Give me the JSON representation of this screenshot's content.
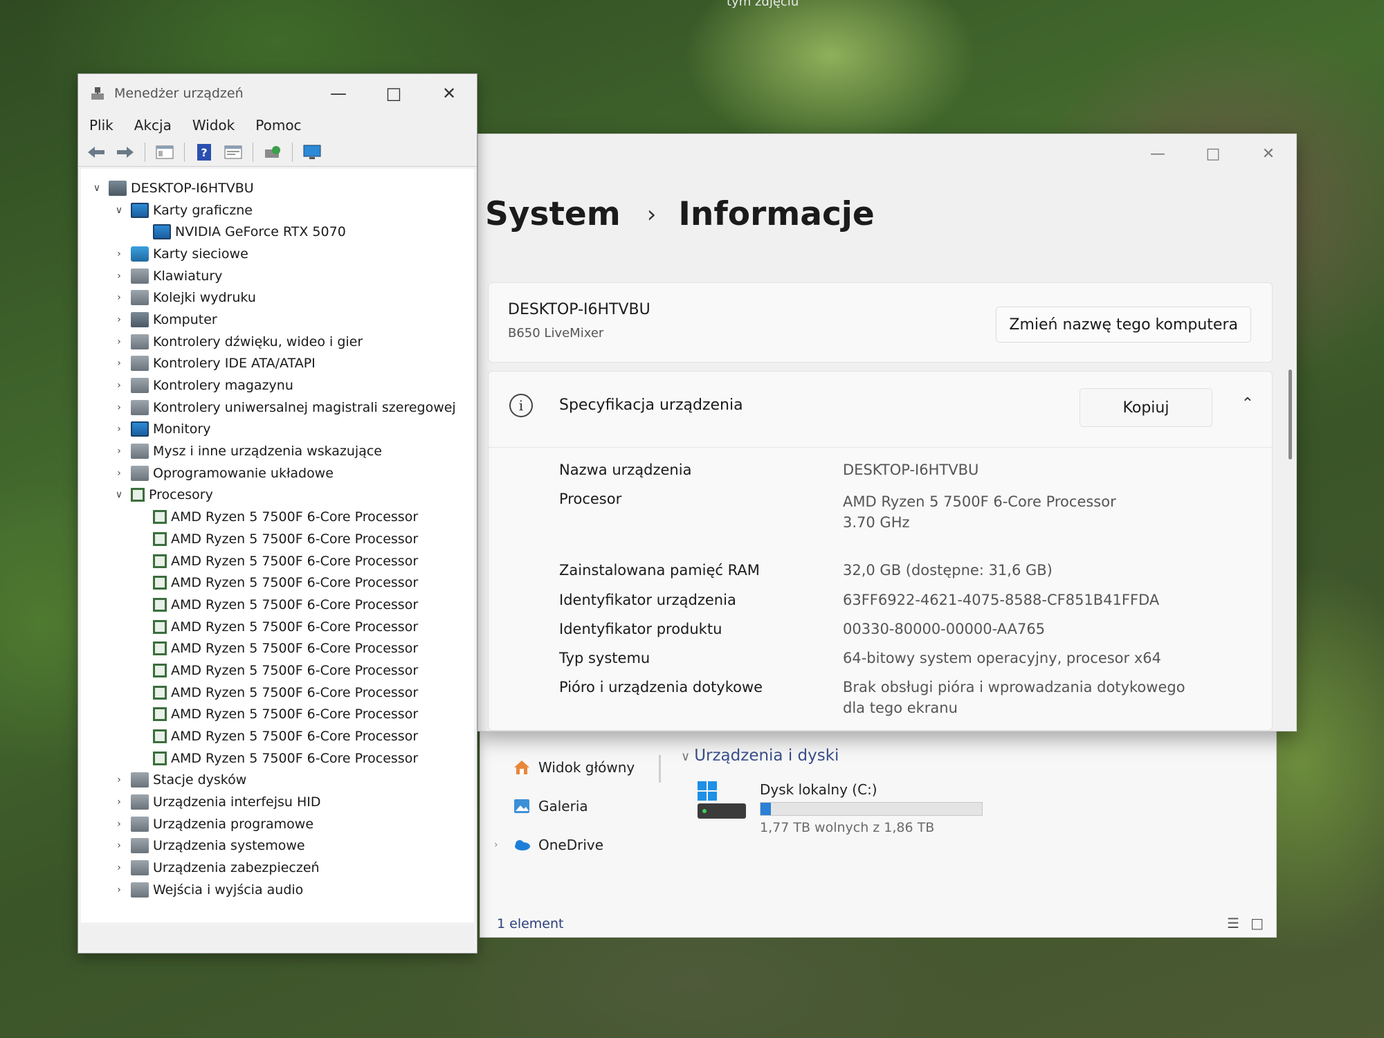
{
  "desktop": {
    "caption": "tym zdjęciu"
  },
  "device_manager": {
    "title": "Menedżer urządzeń",
    "menu": [
      "Plik",
      "Akcja",
      "Widok",
      "Pomoc"
    ],
    "root": "DESKTOP-I6HTVBU",
    "tree": [
      {
        "label": "Karty graficzne",
        "expanded": true,
        "icon": "display-adapter-icon",
        "children": [
          "NVIDIA GeForce RTX 5070"
        ]
      },
      {
        "label": "Karty sieciowe",
        "icon": "network-adapter-icon"
      },
      {
        "label": "Klawiatury",
        "icon": "keyboard-icon"
      },
      {
        "label": "Kolejki wydruku",
        "icon": "printer-icon"
      },
      {
        "label": "Komputer",
        "icon": "computer-icon"
      },
      {
        "label": "Kontrolery dźwięku, wideo i gier",
        "icon": "speaker-icon"
      },
      {
        "label": "Kontrolery IDE ATA/ATAPI",
        "icon": "ide-controller-icon"
      },
      {
        "label": "Kontrolery magazynu",
        "icon": "storage-controller-icon"
      },
      {
        "label": "Kontrolery uniwersalnej magistrali szeregowej",
        "icon": "usb-icon"
      },
      {
        "label": "Monitory",
        "icon": "monitor-icon"
      },
      {
        "label": "Mysz i inne urządzenia wskazujące",
        "icon": "mouse-icon"
      },
      {
        "label": "Oprogramowanie układowe",
        "icon": "firmware-icon"
      },
      {
        "label": "Procesory",
        "expanded": true,
        "icon": "processor-icon",
        "children": [
          "AMD Ryzen 5 7500F 6-Core Processor",
          "AMD Ryzen 5 7500F 6-Core Processor",
          "AMD Ryzen 5 7500F 6-Core Processor",
          "AMD Ryzen 5 7500F 6-Core Processor",
          "AMD Ryzen 5 7500F 6-Core Processor",
          "AMD Ryzen 5 7500F 6-Core Processor",
          "AMD Ryzen 5 7500F 6-Core Processor",
          "AMD Ryzen 5 7500F 6-Core Processor",
          "AMD Ryzen 5 7500F 6-Core Processor",
          "AMD Ryzen 5 7500F 6-Core Processor",
          "AMD Ryzen 5 7500F 6-Core Processor",
          "AMD Ryzen 5 7500F 6-Core Processor"
        ]
      },
      {
        "label": "Stacje dysków",
        "icon": "disk-drive-icon"
      },
      {
        "label": "Urządzenia interfejsu HID",
        "icon": "hid-icon"
      },
      {
        "label": "Urządzenia programowe",
        "icon": "software-device-icon"
      },
      {
        "label": "Urządzenia systemowe",
        "icon": "system-device-icon"
      },
      {
        "label": "Urządzenia zabezpieczeń",
        "icon": "security-device-icon"
      },
      {
        "label": "Wejścia i wyjścia audio",
        "icon": "audio-io-icon"
      }
    ]
  },
  "settings": {
    "breadcrumb": {
      "parent": "System",
      "separator": "›",
      "current": "Informacje"
    },
    "pc": {
      "name": "DESKTOP-I6HTVBU",
      "model": "B650 LiveMixer",
      "rename_label": "Zmień nazwę tego komputera"
    },
    "spec": {
      "title": "Specyfikacja urządzenia",
      "copy_label": "Kopiuj",
      "rows": [
        {
          "label": "Nazwa urządzenia",
          "value": "DESKTOP-I6HTVBU"
        },
        {
          "label": "Procesor",
          "value": "AMD Ryzen 5 7500F 6-Core Processor",
          "value2": "3.70 GHz"
        },
        {
          "label": "Zainstalowana pamięć RAM",
          "value": "32,0 GB (dostępne: 31,6 GB)"
        },
        {
          "label": "Identyfikator urządzenia",
          "value": "63FF6922-4621-4075-8588-CF851B41FFDA"
        },
        {
          "label": "Identyfikator produktu",
          "value": "00330-80000-00000-AA765"
        },
        {
          "label": "Typ systemu",
          "value": "64-bitowy system operacyjny, procesor x64"
        },
        {
          "label": "Pióro i urządzenia dotykowe",
          "value": "Brak obsługi pióra i wprowadzania dotykowego",
          "value2": "dla tego ekranu"
        }
      ]
    }
  },
  "explorer": {
    "nav": [
      "Widok główny",
      "Galeria",
      "OneDrive"
    ],
    "section": "Urządzenia i dyski",
    "drive": {
      "name": "Dysk lokalny (C:)",
      "free": "1,77 TB wolnych z 1,86 TB",
      "used_fraction": 0.048
    },
    "status": "1 element"
  }
}
